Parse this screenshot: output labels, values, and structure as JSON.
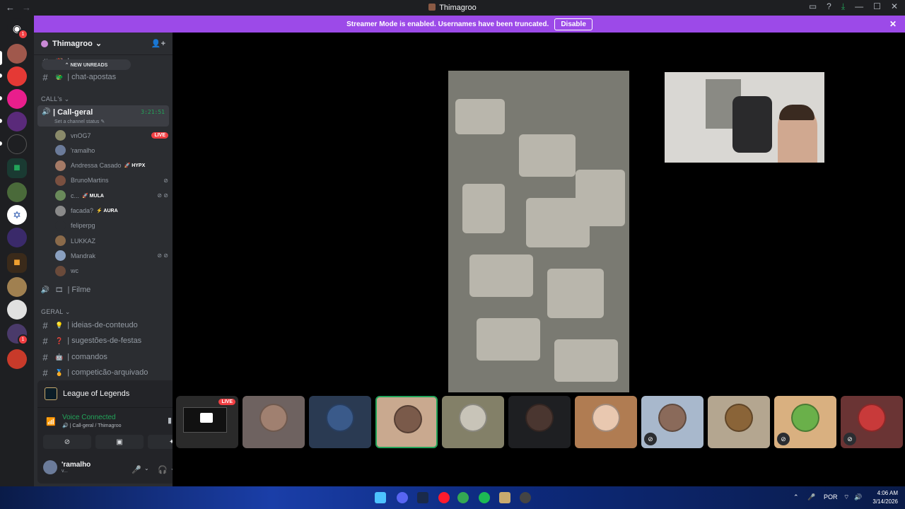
{
  "window": {
    "title": "Thimagroo",
    "nav_back": "←",
    "nav_forward": "→",
    "controls": [
      "▭",
      "?",
      "⤓",
      "—",
      "☐",
      "✕"
    ]
  },
  "banner": {
    "text": "Streamer Mode is enabled. Usernames have been truncated.",
    "button": "Disable",
    "close": "✕"
  },
  "guild_badges": {
    "home": "1",
    "server13": "1"
  },
  "server": {
    "name": "Thimagroo",
    "chevron": "⌄",
    "invite_icon": "👤+"
  },
  "new_unreads": "⌃ NEW UNREADS",
  "channels_top": [
    {
      "label": "| r...",
      "emoji": "🎉"
    },
    {
      "label": "| chat-apostas",
      "emoji": "🐲"
    }
  ],
  "categories": {
    "calls": "CALL's ⌄",
    "geral": "GERAL ⌄"
  },
  "voice_channel": {
    "name": "| Call-geral",
    "time": "3:21:51",
    "status": "Set a channel status ✎"
  },
  "voice_users": [
    {
      "name": "vnOG7",
      "tag": "",
      "live": "LIVE",
      "icons": "",
      "color": "#8a8a6a"
    },
    {
      "name": "'ramalho",
      "tag": "",
      "live": "",
      "icons": "",
      "color": "#6b7b9a"
    },
    {
      "name": "Andressa Casado",
      "tag": "🚀 HYPX",
      "live": "",
      "icons": "",
      "color": "#a57a66"
    },
    {
      "name": "BrunoMartins",
      "tag": "",
      "live": "",
      "icons": "⊘",
      "color": "#7a5040"
    },
    {
      "name": "c...",
      "tag": "🚀 MULA",
      "live": "",
      "icons": "⊘ ⊘",
      "color": "#6a8a5a"
    },
    {
      "name": "facada?",
      "tag": "⚡ AURA",
      "live": "",
      "icons": "",
      "color": "#8a8a8a"
    },
    {
      "name": "feliperpg",
      "tag": "",
      "live": "",
      "icons": "",
      "color": "#2b2d31"
    },
    {
      "name": "LUKKAZ",
      "tag": "",
      "live": "",
      "icons": "",
      "color": "#8a6a4a"
    },
    {
      "name": "Mandrak",
      "tag": "",
      "live": "",
      "icons": "⊘ ⊘",
      "color": "#8aa0c0"
    },
    {
      "name": "wc",
      "tag": "",
      "live": "",
      "icons": "",
      "color": "#6a4a3a"
    }
  ],
  "filme_channel": "| Filme",
  "channels_geral": [
    {
      "label": "| ideias-de-conteudo",
      "emoji": "💡"
    },
    {
      "label": "| sugestões-de-festas",
      "emoji": "❓"
    },
    {
      "label": "| comandos",
      "emoji": "🤖"
    },
    {
      "label": "| competicão-arquivado",
      "emoji": "🏅"
    }
  ],
  "activity": {
    "game": "League of Legends"
  },
  "voice_panel": {
    "status": "Voice Connected",
    "channel": "🔊 | Call-geral / Thimagroo"
  },
  "user": {
    "name": "'ramalho",
    "status": "v..."
  },
  "thumb_live": "LIVE",
  "thumbs": [
    {
      "type": "screen",
      "bg": "#2a2a2a",
      "face": "#bbbbbb",
      "mute": false
    },
    {
      "type": "cam",
      "bg": "#6e6260",
      "face": "#a08070",
      "mute": false
    },
    {
      "type": "cam",
      "bg": "#2a3a52",
      "face": "#3a5a8a",
      "mute": false
    },
    {
      "type": "cam",
      "bg": "#c9a98f",
      "face": "#7a5a4a",
      "mute": false,
      "speaking": true
    },
    {
      "type": "cam",
      "bg": "#838068",
      "face": "#c8c4b8",
      "mute": false
    },
    {
      "type": "cam",
      "bg": "#1e1f22",
      "face": "#4a3630",
      "mute": false
    },
    {
      "type": "cam",
      "bg": "#b07c52",
      "face": "#e9c8b0",
      "mute": false
    },
    {
      "type": "cam",
      "bg": "#a8b8cc",
      "face": "#8a6a5a",
      "mute": true
    },
    {
      "type": "cam",
      "bg": "#b4a690",
      "face": "#8a6438",
      "mute": false
    },
    {
      "type": "cam",
      "bg": "#d9b080",
      "face": "#6ab04a",
      "mute": true
    },
    {
      "type": "cam",
      "bg": "#6a3434",
      "face": "#c83a3a",
      "mute": true
    }
  ],
  "tray": {
    "lang": "POR",
    "chevron": "⌃",
    "mic": "🎤",
    "time": "4:06 AM",
    "date": "3/14/2026"
  },
  "colors": {
    "accent": "#9c4ae8",
    "online": "#23a55a",
    "live": "#f23f43",
    "bg_sidebar": "#2b2d31"
  }
}
